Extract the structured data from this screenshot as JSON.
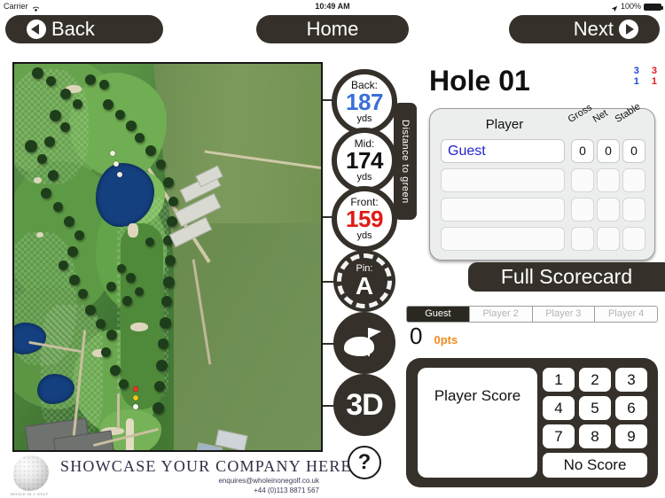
{
  "statusbar": {
    "carrier": "Carrier",
    "wifi_icon": "wifi-icon",
    "time": "10:49 AM",
    "location_icon": "location-arrow-icon",
    "battery_percent": "100%",
    "battery_icon": "battery-full-icon"
  },
  "nav": {
    "back_label": "Back",
    "home_label": "Home",
    "next_label": "Next"
  },
  "distances": {
    "group_label": "Distance to green",
    "items": [
      {
        "label": "Back:",
        "value": "187",
        "unit": "yds",
        "color": "#3a6fd8"
      },
      {
        "label": "Mid:",
        "value": "174",
        "unit": "yds",
        "color": "#111111"
      },
      {
        "label": "Front:",
        "value": "159",
        "unit": "yds",
        "color": "#e01b16"
      }
    ]
  },
  "pin": {
    "label": "Pin:",
    "value": "A"
  },
  "tools": {
    "green_view_icon": "green-flag-icon",
    "three_d_label": "3D",
    "help_label": "?"
  },
  "hole": {
    "title": "Hole 01",
    "par_blue": "3",
    "si_blue": "1",
    "par_red": "3",
    "si_red": "1"
  },
  "scorecard": {
    "headers": {
      "player": "Player",
      "gross": "Gross",
      "net": "Net",
      "stable": "Stable"
    },
    "rows": [
      {
        "name": "Guest",
        "gross": "0",
        "net": "0",
        "stable": "0"
      },
      {
        "name": "",
        "gross": "",
        "net": "",
        "stable": ""
      },
      {
        "name": "",
        "gross": "",
        "net": "",
        "stable": ""
      },
      {
        "name": "",
        "gross": "",
        "net": "",
        "stable": ""
      }
    ],
    "full_scorecard_label": "Full Scorecard"
  },
  "player_tabs": [
    {
      "label": "Guest",
      "active": true
    },
    {
      "label": "Player 2",
      "active": false
    },
    {
      "label": "Player 3",
      "active": false
    },
    {
      "label": "Player 4",
      "active": false
    }
  ],
  "score_summary": {
    "strokes": "0",
    "points": "0pts"
  },
  "keypad": {
    "display_placeholder": "Player Score",
    "keys": [
      "1",
      "2",
      "3",
      "4",
      "5",
      "6",
      "7",
      "8",
      "9"
    ],
    "no_score_label": "No Score"
  },
  "banner": {
    "logo_icon": "golf-ball-logo",
    "logo_caption": "WHOLE IN 1 GOLF",
    "title": "SHOWCASE YOUR COMPANY HERE",
    "email": "enquires@wholeinonegolf.co.uk",
    "phone": "+44 (0)113 8871 567"
  },
  "colors": {
    "chrome_dark": "#35312a",
    "accent_blue": "#3a6fd8",
    "accent_red": "#e01b16",
    "accent_orange": "#ee8c22",
    "panel_grey": "#eceded"
  }
}
